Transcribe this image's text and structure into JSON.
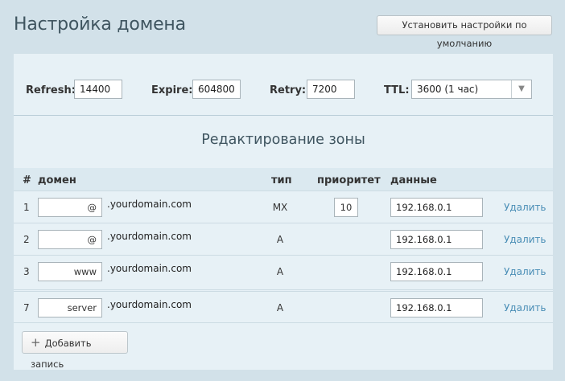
{
  "page": {
    "title": "Настройка домена",
    "default_button": "Установить настройки по умолчанию"
  },
  "soa": {
    "refresh_label": "Refresh:",
    "refresh_value": "14400",
    "expire_label": "Expire:",
    "expire_value": "604800",
    "retry_label": "Retry:",
    "retry_value": "7200",
    "ttl_label": "TTL:",
    "ttl_value": "3600 (1 час)"
  },
  "zone": {
    "title": "Редактирование зоны",
    "columns": {
      "num": "#",
      "domain": "домен",
      "type": "тип",
      "priority": "приоритет",
      "data": "данные"
    },
    "rows": [
      {
        "num": "1",
        "host": "@",
        "suffix": ".yourdomain.com",
        "type": "MX",
        "priority": "10",
        "data": "192.168.0.1",
        "delete": "Удалить"
      },
      {
        "num": "2",
        "host": "@",
        "suffix": ".yourdomain.com",
        "type": "A",
        "priority": "",
        "data": "192.168.0.1",
        "delete": "Удалить"
      },
      {
        "num": "3",
        "host": "www",
        "suffix": ".yourdomain.com",
        "type": "A",
        "priority": "",
        "data": "192.168.0.1",
        "delete": "Удалить"
      },
      {
        "num": "7",
        "host": "server",
        "suffix": ".yourdomain.com",
        "type": "A",
        "priority": "",
        "data": "192.168.0.1",
        "delete": "Удалить"
      }
    ],
    "add_button": "Добавить запись"
  }
}
